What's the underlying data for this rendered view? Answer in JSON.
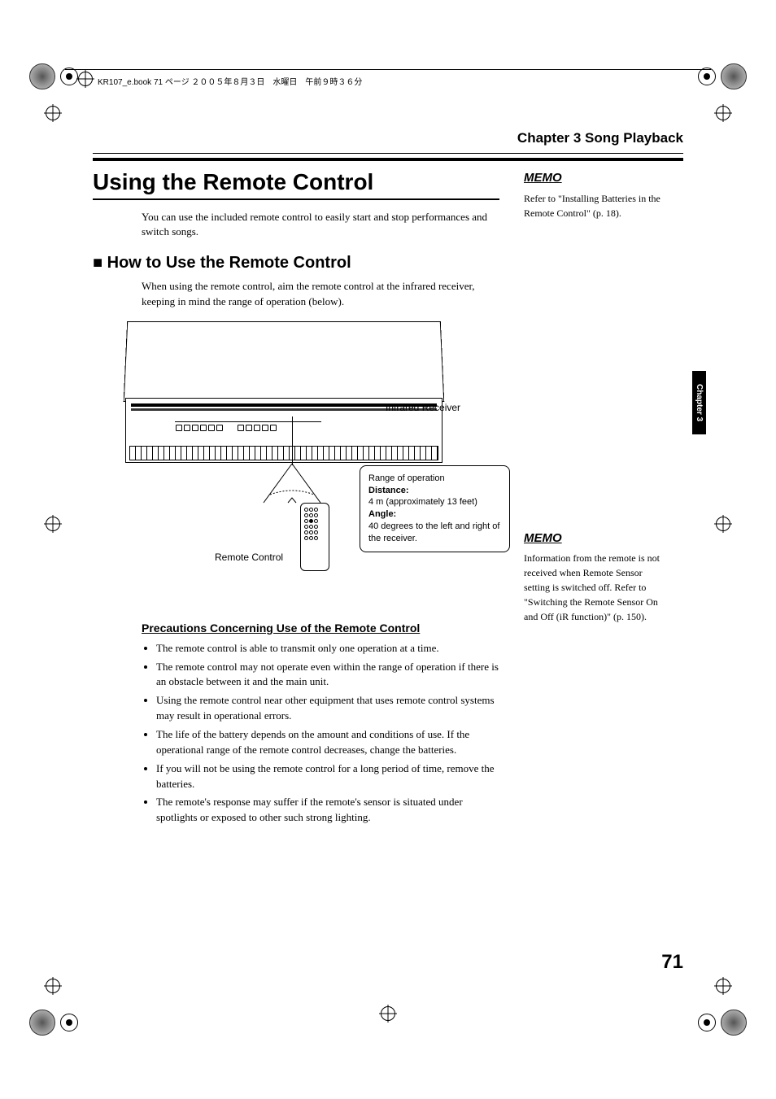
{
  "header_line": "KR107_e.book  71 ページ  ２００５年８月３日　水曜日　午前９時３６分",
  "chapter_header": "Chapter 3 Song Playback",
  "title": "Using the Remote Control",
  "intro": "You can use the included remote control to easily start and stop performances and switch songs.",
  "section_heading": "How to Use the Remote Control",
  "section_body": "When using the remote control, aim the remote control at the infrared receiver, keeping in mind the range of operation (below).",
  "diagram": {
    "ir_label": "Infrared Receiver",
    "remote_label": "Remote Control",
    "range_title": "Range of operation",
    "distance_label": "Distance:",
    "distance_value": "4 m (approximately 13 feet)",
    "angle_label": "Angle:",
    "angle_value": "40 degrees to the left and right of the receiver."
  },
  "precautions_heading": "Precautions Concerning Use of the Remote Control",
  "precautions": [
    "The remote control is able to transmit only one operation at a time.",
    "The remote control may not operate even within the range of operation if there is an obstacle between it and the main unit.",
    "Using the remote control near other equipment that uses remote control systems may result in operational errors.",
    "The life of the battery depends on the amount and conditions of use. If the operational range of the remote control decreases, change the batteries.",
    "If you will not be using the remote control for a long period of time, remove the batteries.",
    "The remote's response may suffer if the remote's sensor is situated under spotlights or exposed to other such strong lighting."
  ],
  "memo_label": "MEMO",
  "memo1": "Refer to \"Installing Batteries in the Remote Control\" (p. 18).",
  "memo2": "Information from the remote is not received when Remote Sensor setting is switched off. Refer to \"Switching the Remote Sensor On and Off (iR function)\" (p. 150).",
  "chapter_tab": "Chapter 3",
  "page_number": "71"
}
